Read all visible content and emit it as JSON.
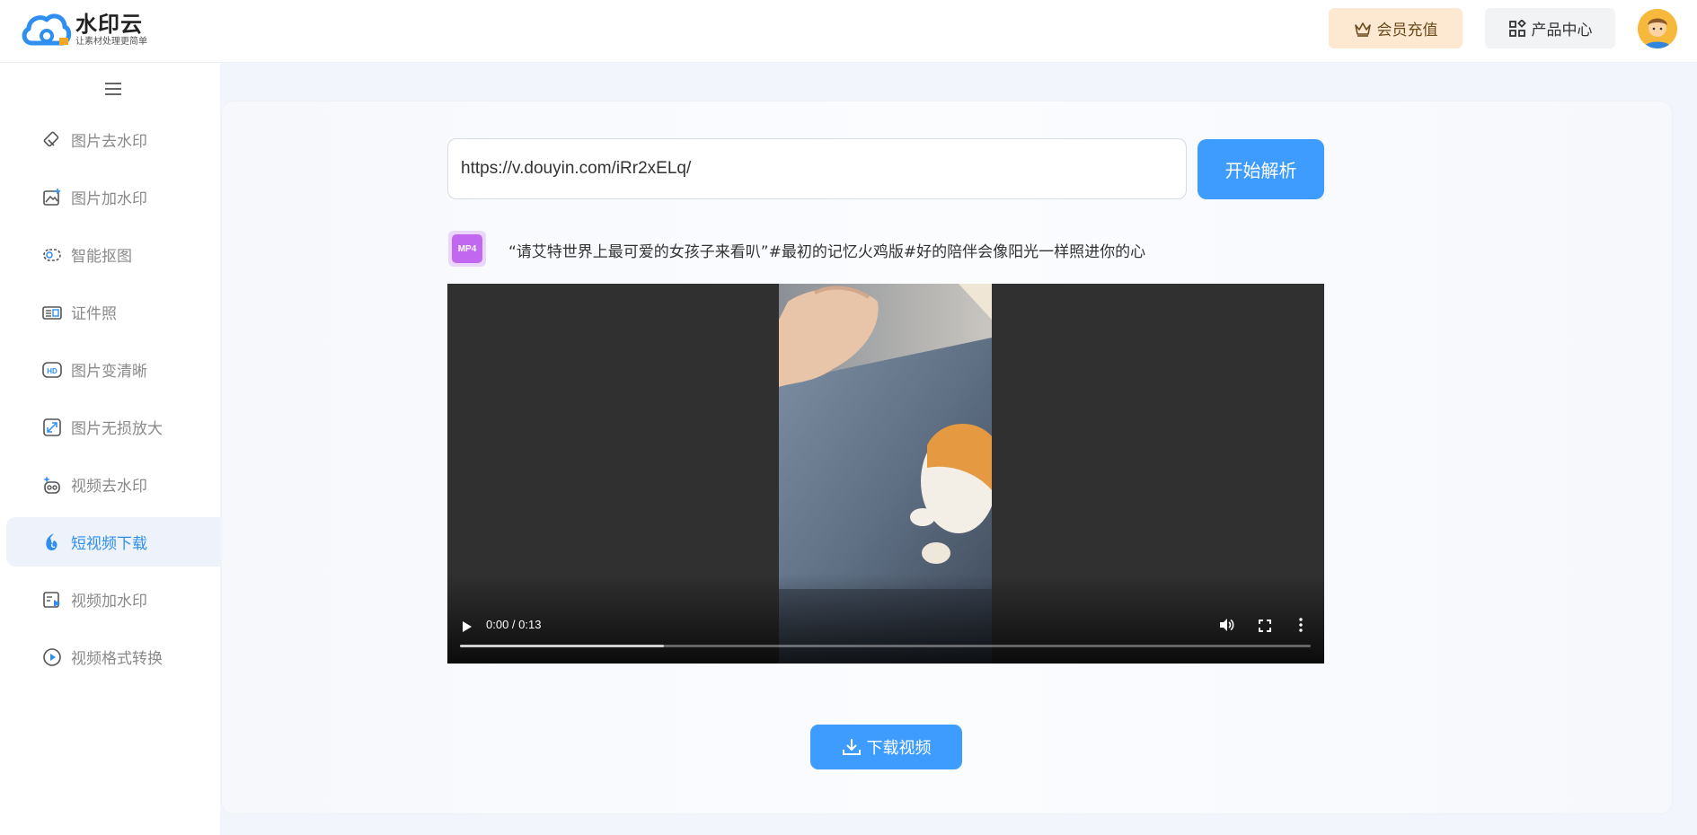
{
  "brand": {
    "title": "水印云",
    "subtitle": "让素材处理更简单"
  },
  "header": {
    "vip_label": "会员充值",
    "products_label": "产品中心"
  },
  "sidebar": {
    "items": [
      {
        "label": "图片去水印",
        "icon": "eraser-icon",
        "active": false
      },
      {
        "label": "图片加水印",
        "icon": "image-add-icon",
        "active": false
      },
      {
        "label": "智能抠图",
        "icon": "cutout-icon",
        "active": false
      },
      {
        "label": "证件照",
        "icon": "id-card-icon",
        "active": false
      },
      {
        "label": "图片变清晰",
        "icon": "hd-icon",
        "active": false
      },
      {
        "label": "图片无损放大",
        "icon": "expand-icon",
        "active": false
      },
      {
        "label": "视频去水印",
        "icon": "video-clean-icon",
        "active": false
      },
      {
        "label": "短视频下载",
        "icon": "short-video-icon",
        "active": true
      },
      {
        "label": "视频加水印",
        "icon": "video-mark-icon",
        "active": false
      },
      {
        "label": "视频格式转换",
        "icon": "play-circle-icon",
        "active": false
      }
    ]
  },
  "main": {
    "url_value": "https://v.douyin.com/iRr2xELq/",
    "parse_label": "开始解析",
    "format_badge": "MP4",
    "video_title": "“请艾特世界上最可爱的女孩子来看叭”#最初的记忆火鸡版#好的陪伴会像阳光一样照进你的心",
    "player": {
      "time_display": "0:00 / 0:13",
      "buffered_fraction": 0.24
    },
    "download_label": "下载视频"
  },
  "colors": {
    "accent": "#3f9cff",
    "vip_bg": "#fde9d1",
    "active_nav_bg": "#eef3fb",
    "active_nav_text": "#2f8ff0",
    "mp4_badge": "#c167f0"
  }
}
